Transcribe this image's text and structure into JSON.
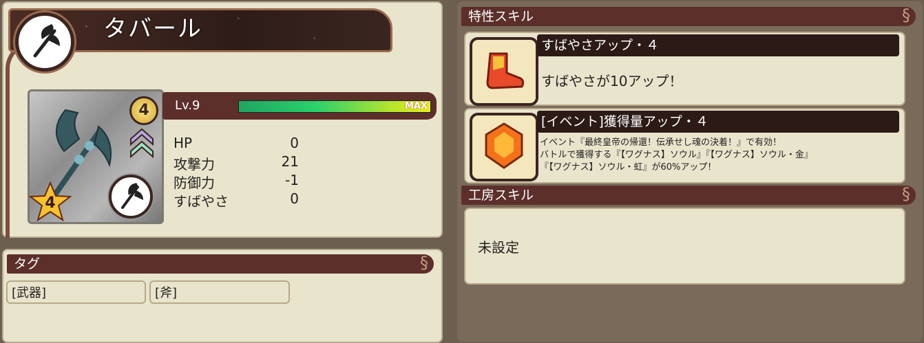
{
  "item": {
    "name": "タバール",
    "rank": "4",
    "rarity_stars": "4",
    "level_label": "Lv.9",
    "level_status": "MAX",
    "exp_fill_percent": 100,
    "stats": [
      {
        "label": "HP",
        "value": "0"
      },
      {
        "label": "攻撃力",
        "value": "21"
      },
      {
        "label": "防御力",
        "value": "-1"
      },
      {
        "label": "すばやさ",
        "value": "0"
      }
    ]
  },
  "tags": {
    "header": "タグ",
    "items": [
      "[武器]",
      "[斧]"
    ]
  },
  "trait_skills": {
    "header": "特性スキル",
    "items": [
      {
        "title": "すばやさアップ・４",
        "description": "すばやさが10アップ！",
        "icon": "boot-icon"
      },
      {
        "title": "[イベント]獲得量アップ・４",
        "description_lines": [
          "イベント『最終皇帝の帰還！伝承せし魂の決着！』で有効！",
          "バトルで獲得する『【ワグナス】ソウル』『【ワグナス】ソウル・金』",
          "『【ワグナス】ソウル・虹』が60%アップ！"
        ],
        "icon": "gem-icon"
      }
    ]
  },
  "workshop_skill": {
    "header": "工房スキル",
    "value": "未設定"
  },
  "colors": {
    "panel": "#e9e4cc",
    "header": "#5c2f2a",
    "title_bar": "#2b1a16",
    "exp_bar": "#2bd06c"
  }
}
